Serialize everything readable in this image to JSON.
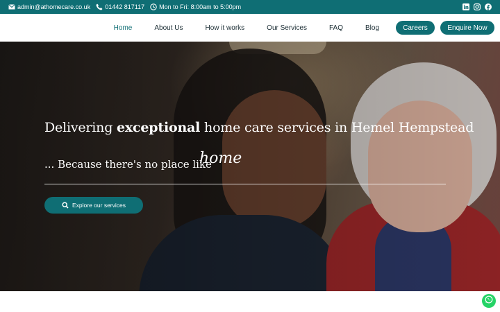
{
  "topbar": {
    "email": "admin@athomecare.co.uk",
    "phone": "01442 817117",
    "hours": "Mon to Fri: 8:00am to 5:00pm",
    "icons": [
      "mail-icon",
      "phone-icon",
      "clock-icon",
      "linkedin-icon",
      "instagram-icon",
      "facebook-icon"
    ]
  },
  "nav": {
    "items": [
      {
        "label": "Home",
        "active": true
      },
      {
        "label": "About Us"
      },
      {
        "label": "How it works"
      },
      {
        "label": "Our Services"
      },
      {
        "label": "FAQ"
      },
      {
        "label": "Blog"
      }
    ],
    "careers": "Careers",
    "enquire": "Enquire Now"
  },
  "hero": {
    "headline_pre": "Delivering ",
    "headline_bold": "exceptional",
    "headline_post": " home care services in Hemel Hempstead",
    "tagline": "... Because there's no place like",
    "script_word": "home",
    "cta": "Explore our services"
  },
  "colors": {
    "brand": "#0f6e74",
    "whatsapp": "#25d366"
  }
}
